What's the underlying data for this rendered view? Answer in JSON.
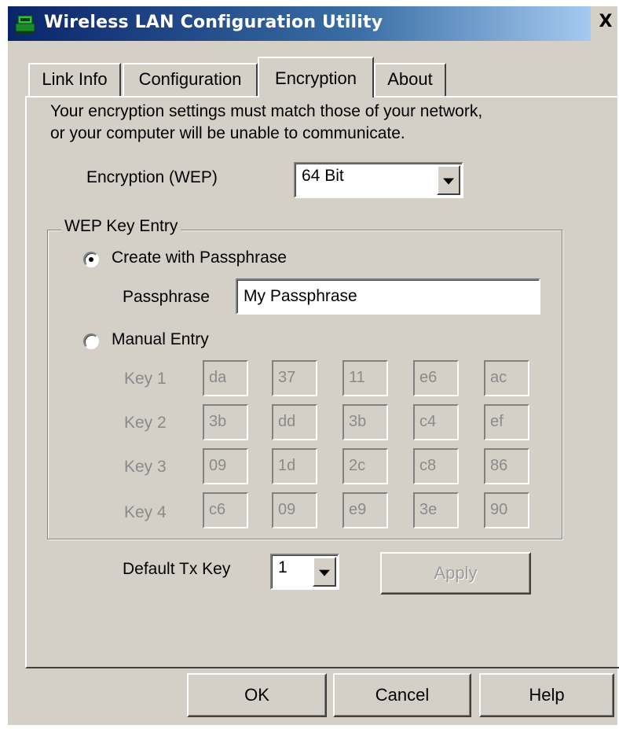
{
  "window": {
    "title": "Wireless LAN Configuration Utility",
    "close_label": "X",
    "titlebar_color_start": "#0a246a",
    "titlebar_color_end": "#a6caf0",
    "face_color": "#d4d0c8"
  },
  "tabs": [
    {
      "label": "Link Info",
      "active": false
    },
    {
      "label": "Configuration",
      "active": false
    },
    {
      "label": "Encryption",
      "active": true
    },
    {
      "label": "About",
      "active": false
    }
  ],
  "encryption": {
    "notice_line1": "Your encryption settings must match those of your network,",
    "notice_line2": "or your computer will be unable to communicate.",
    "wep_label": "Encryption (WEP)",
    "wep_value": "64 Bit"
  },
  "wep_key_entry": {
    "group_title": "WEP Key Entry",
    "passphrase_option_label": "Create with Passphrase",
    "passphrase_selected": true,
    "passphrase_label": "Passphrase",
    "passphrase_value": "My Passphrase",
    "manual_option_label": "Manual Entry",
    "manual_selected": false,
    "keys": [
      {
        "label": "Key 1",
        "bytes": [
          "da",
          "37",
          "11",
          "e6",
          "ac"
        ]
      },
      {
        "label": "Key 2",
        "bytes": [
          "3b",
          "dd",
          "3b",
          "c4",
          "ef"
        ]
      },
      {
        "label": "Key 3",
        "bytes": [
          "09",
          "1d",
          "2c",
          "c8",
          "86"
        ]
      },
      {
        "label": "Key 4",
        "bytes": [
          "c6",
          "09",
          "e9",
          "3e",
          "90"
        ]
      }
    ]
  },
  "tx_key": {
    "label": "Default Tx Key",
    "value": "1"
  },
  "buttons": {
    "apply": "Apply",
    "ok": "OK",
    "cancel": "Cancel",
    "help": "Help"
  }
}
